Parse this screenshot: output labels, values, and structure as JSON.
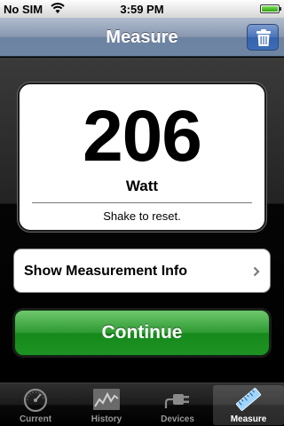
{
  "status_bar": {
    "carrier": "No SIM",
    "time": "3:59 PM"
  },
  "nav": {
    "title": "Measure",
    "right_button_icon": "trash-icon"
  },
  "measurement": {
    "value": "206",
    "unit": "Watt",
    "hint": "Shake to reset."
  },
  "info_row": {
    "label": "Show Measurement Info",
    "icon": "chevron-right-icon"
  },
  "continue_button": {
    "label": "Continue",
    "color": "#1e9324"
  },
  "tabs": [
    {
      "label": "Current",
      "icon": "gauge-icon",
      "selected": false
    },
    {
      "label": "History",
      "icon": "graph-icon",
      "selected": false
    },
    {
      "label": "Devices",
      "icon": "plug-icon",
      "selected": false
    },
    {
      "label": "Measure",
      "icon": "ruler-icon",
      "selected": true
    }
  ]
}
